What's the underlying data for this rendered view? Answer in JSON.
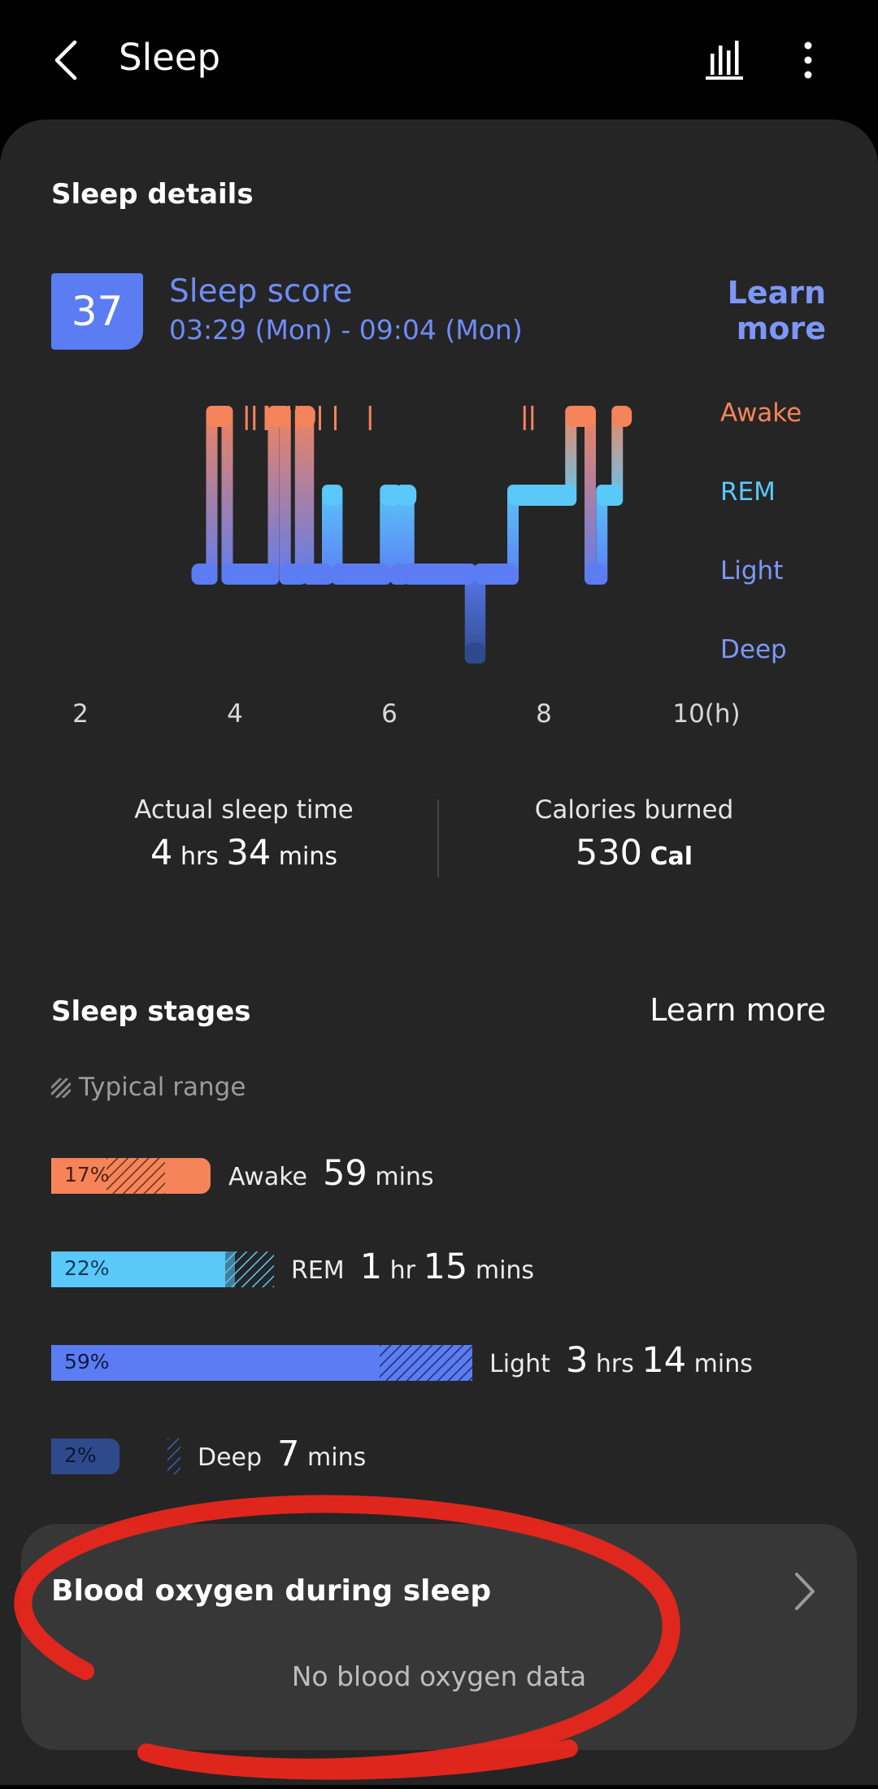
{
  "header": {
    "title": "Sleep"
  },
  "icons": {
    "back": "chevron-left-icon",
    "stats": "bar-chart-icon",
    "more": "more-vertical-icon"
  },
  "sleep_details": {
    "title": "Sleep details",
    "score": "37",
    "score_label": "Sleep score",
    "time_range": "03:29 (Mon) - 09:04 (Mon)",
    "learn_more": "Learn more"
  },
  "chart_data": {
    "type": "line",
    "stages": [
      "Awake",
      "REM",
      "Light",
      "Deep"
    ],
    "x_ticks": [
      "2",
      "4",
      "6",
      "8",
      "10(h)"
    ],
    "xlim": [
      1.6,
      11.4
    ],
    "segments": [
      {
        "start": 3.5,
        "end": 3.7,
        "stage": "Light"
      },
      {
        "start": 3.7,
        "end": 3.9,
        "stage": "Awake"
      },
      {
        "start": 3.9,
        "end": 4.5,
        "stage": "Light"
      },
      {
        "start": 4.5,
        "end": 4.65,
        "stage": "Awake"
      },
      {
        "start": 4.65,
        "end": 4.85,
        "stage": "Light"
      },
      {
        "start": 4.85,
        "end": 4.95,
        "stage": "Awake"
      },
      {
        "start": 4.95,
        "end": 5.2,
        "stage": "Light"
      },
      {
        "start": 5.2,
        "end": 5.32,
        "stage": "REM"
      },
      {
        "start": 5.32,
        "end": 5.95,
        "stage": "Light"
      },
      {
        "start": 5.95,
        "end": 6.08,
        "stage": "REM"
      },
      {
        "start": 6.08,
        "end": 6.16,
        "stage": "Light"
      },
      {
        "start": 6.16,
        "end": 6.25,
        "stage": "REM"
      },
      {
        "start": 6.25,
        "end": 7.05,
        "stage": "Light"
      },
      {
        "start": 7.05,
        "end": 7.17,
        "stage": "Deep"
      },
      {
        "start": 7.17,
        "end": 7.6,
        "stage": "Light"
      },
      {
        "start": 7.6,
        "end": 8.35,
        "stage": "REM"
      },
      {
        "start": 8.35,
        "end": 8.6,
        "stage": "Awake"
      },
      {
        "start": 8.6,
        "end": 8.75,
        "stage": "Light"
      },
      {
        "start": 8.75,
        "end": 8.95,
        "stage": "REM"
      },
      {
        "start": 8.95,
        "end": 9.07,
        "stage": "Awake"
      }
    ],
    "awake_ticks": [
      4.15,
      4.25,
      4.4,
      4.42,
      4.7,
      4.8,
      5.1,
      5.3,
      5.75,
      7.75,
      7.85
    ]
  },
  "metrics": {
    "actual_sleep": {
      "label": "Actual sleep time",
      "hrs": "4",
      "hrs_unit": "hrs",
      "mins": "34",
      "mins_unit": "mins"
    },
    "calories": {
      "label": "Calories burned",
      "value": "530",
      "unit": "Cal"
    }
  },
  "sleep_stages": {
    "title": "Sleep stages",
    "learn_more": "Learn more",
    "typical_range": "Typical range",
    "rows": [
      {
        "name": "Awake",
        "pct": "17%",
        "fraction": 0.17,
        "color": "#f5845a",
        "v1": "59",
        "u1": "mins",
        "v2": "",
        "u2": ""
      },
      {
        "name": "REM",
        "pct": "22%",
        "fraction": 0.22,
        "color": "#5bc8fa",
        "v1": "1",
        "u1": "hr",
        "v2": "15",
        "u2": "mins"
      },
      {
        "name": "Light",
        "pct": "59%",
        "fraction": 0.59,
        "color": "#5b7cf2",
        "v1": "3",
        "u1": "hrs",
        "v2": "14",
        "u2": "mins"
      },
      {
        "name": "Deep",
        "pct": "2%",
        "fraction": 0.02,
        "color": "#2f4a8c",
        "v1": "7",
        "u1": "mins",
        "v2": "",
        "u2": ""
      }
    ]
  },
  "blood_oxygen": {
    "title": "Blood oxygen during sleep",
    "empty": "No blood oxygen data"
  },
  "colors": {
    "awake": "#f5845a",
    "rem": "#5bc8fa",
    "light": "#5b7cf2",
    "deep": "#2f4a8c",
    "annotation": "#e8261c"
  }
}
